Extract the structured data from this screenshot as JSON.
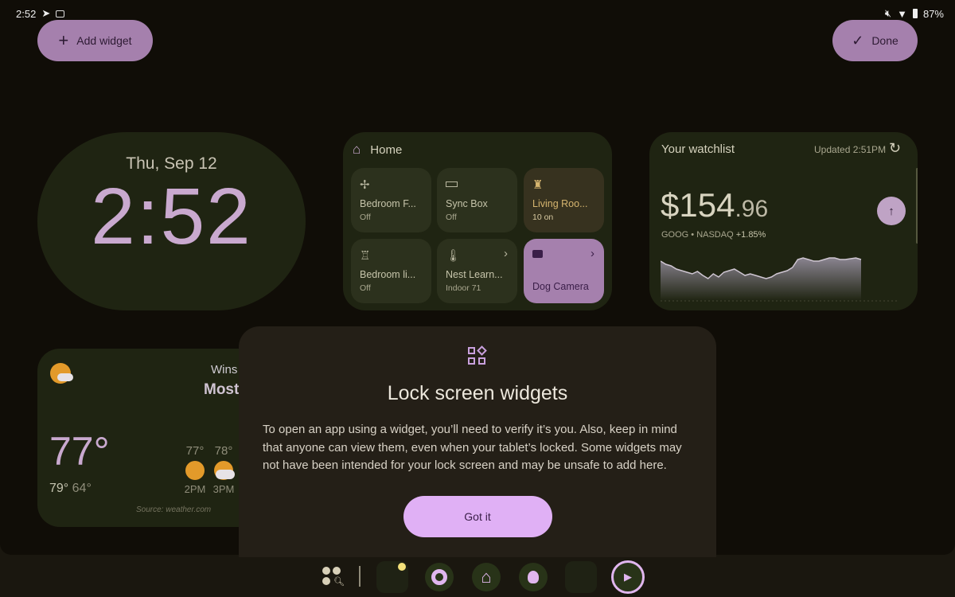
{
  "status_bar": {
    "time": "2:52",
    "battery": "87%",
    "icons": [
      "telegram-icon",
      "news-icon",
      "mute-icon",
      "wifi-icon",
      "battery-icon"
    ]
  },
  "toolbar": {
    "add_widget": "Add widget",
    "done": "Done"
  },
  "clock": {
    "date": "Thu, Sep 12",
    "time": "2:52"
  },
  "home": {
    "title": "Home",
    "tiles": [
      {
        "name": "Bedroom F...",
        "status": "Off",
        "icon": "fan-icon"
      },
      {
        "name": "Sync Box",
        "status": "Off",
        "icon": "sync-box-icon"
      },
      {
        "name": "Living Roo...",
        "status": "10 on",
        "icon": "lamp-icon"
      },
      {
        "name": "Bedroom li...",
        "status": "Off",
        "icon": "lamp-icon"
      },
      {
        "name": "Nest Learn...",
        "status": "Indoor 71",
        "icon": "thermometer-icon"
      },
      {
        "name": "Dog Camera",
        "status": "",
        "icon": "camera-icon"
      }
    ]
  },
  "watchlist": {
    "title": "Your watchlist",
    "updated": "Updated 2:51PM",
    "price_main": "$154",
    "price_dec": ".96",
    "ticker": "GOOG • NASDAQ",
    "change": "+1.85%"
  },
  "weather": {
    "location_partial": "Wins",
    "condition_partial": "Most",
    "temp": "77°",
    "high": "79°",
    "low": "64°",
    "hourly": [
      {
        "temp": "77°",
        "time": "2PM"
      },
      {
        "temp": "78°",
        "time": "3PM"
      }
    ],
    "source": "Source: weather.com"
  },
  "dialog": {
    "title": "Lock screen widgets",
    "body": "To open an app using a widget, you’ll need to verify it’s you. Also, keep in mind that anyone can view them, even when your tablet’s locked. Some widgets may not have been intended for your lock screen and may be unsafe to add here.",
    "button": "Got it"
  },
  "colors": {
    "accent": "#a580ad",
    "dialog_button": "#e0b0f5",
    "card": "#1f2412",
    "dialog_bg": "#241f17"
  }
}
